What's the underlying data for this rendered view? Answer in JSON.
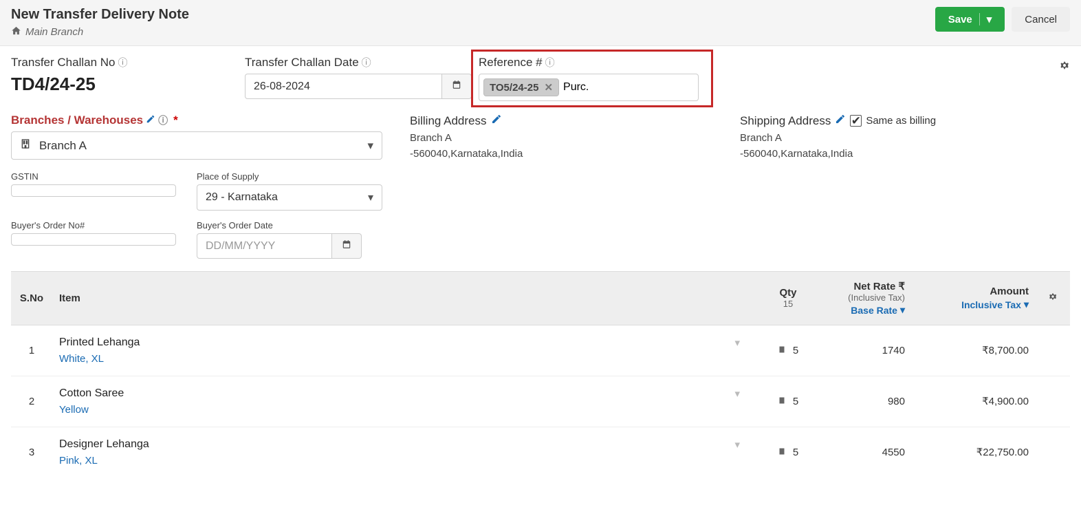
{
  "header": {
    "title": "New Transfer Delivery Note",
    "branch": "Main Branch",
    "save": "Save",
    "cancel": "Cancel"
  },
  "fields": {
    "challan_no_label": "Transfer Challan No",
    "challan_no_value": "TD4/24-25",
    "challan_date_label": "Transfer Challan Date",
    "challan_date_value": "26-08-2024",
    "reference_label": "Reference #",
    "reference_tag": "TO5/24-25",
    "reference_input": "Purc.",
    "branches_label": "Branches / Warehouses",
    "branch_value": "Branch A",
    "billing_label": "Billing Address",
    "billing_line1": "Branch A",
    "billing_line2": "-560040,Karnataka,India",
    "shipping_label": "Shipping Address",
    "same_as_billing": "Same as billing",
    "shipping_line1": "Branch A",
    "shipping_line2": "-560040,Karnataka,India",
    "gstin_label": "GSTIN",
    "pos_label": "Place of Supply",
    "pos_value": "29 - Karnataka",
    "buyer_order_no_label": "Buyer's Order No#",
    "buyer_order_date_label": "Buyer's Order Date",
    "buyer_order_date_placeholder": "DD/MM/YYYY"
  },
  "table": {
    "h_sno": "S.No",
    "h_item": "Item",
    "h_qty": "Qty",
    "h_qty_total": "15",
    "h_rate": "Net Rate ₹",
    "h_rate_sub": "(Inclusive Tax)",
    "h_rate_link": "Base Rate",
    "h_amount": "Amount",
    "h_amount_link": "Inclusive Tax",
    "rows": [
      {
        "sno": "1",
        "name": "Printed Lehanga",
        "variant": "White, XL",
        "qty": "5",
        "rate": "1740",
        "amount": "₹8,700.00"
      },
      {
        "sno": "2",
        "name": "Cotton Saree",
        "variant": "Yellow",
        "qty": "5",
        "rate": "980",
        "amount": "₹4,900.00"
      },
      {
        "sno": "3",
        "name": "Designer Lehanga",
        "variant": "Pink, XL",
        "qty": "5",
        "rate": "4550",
        "amount": "₹22,750.00"
      }
    ]
  }
}
